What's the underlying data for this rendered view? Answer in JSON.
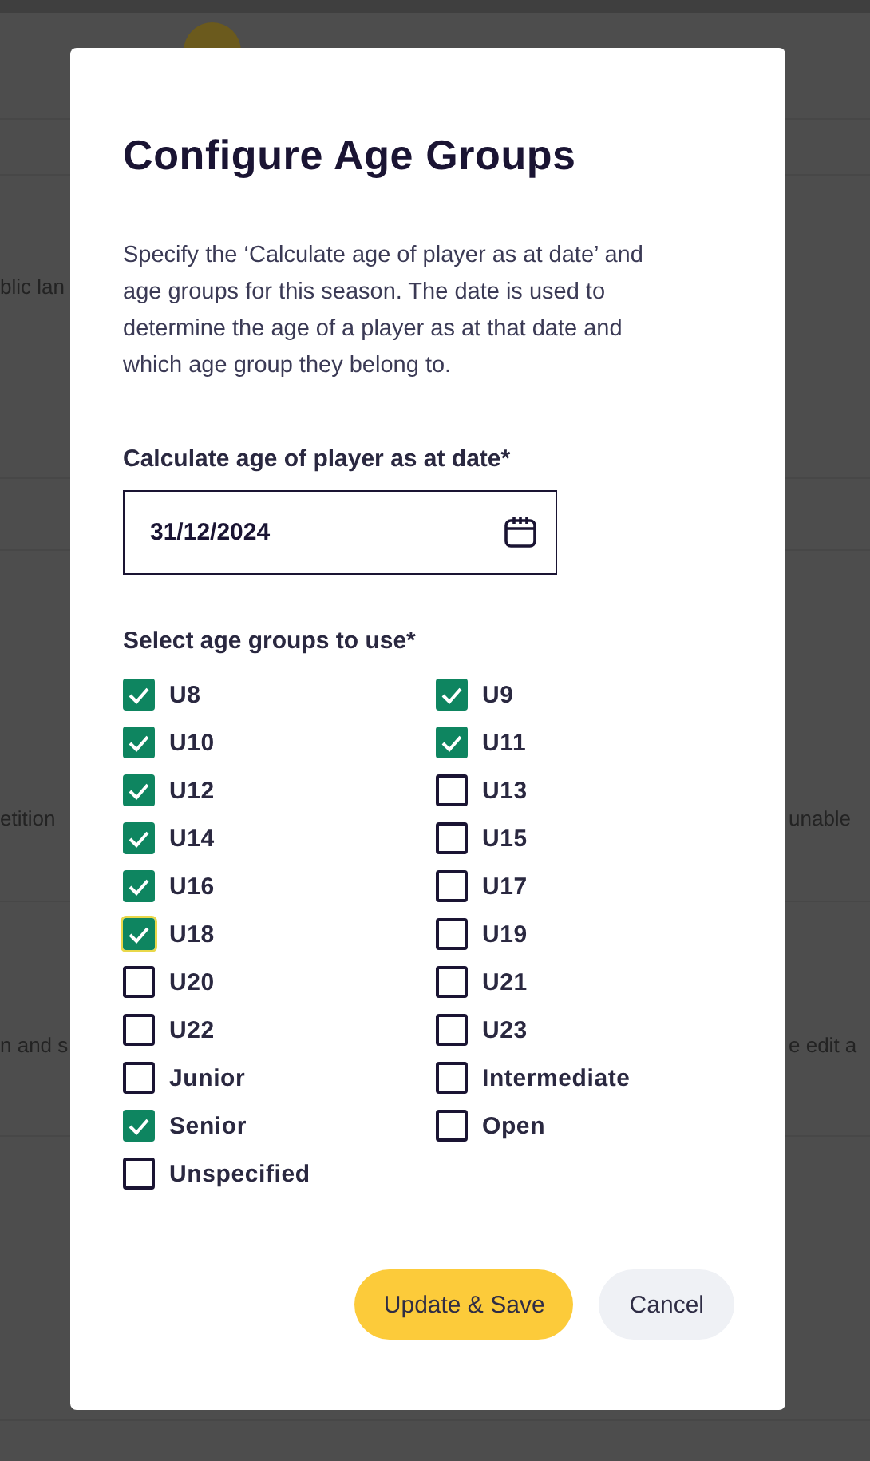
{
  "background": {
    "fragments": [
      {
        "left": "blic lan"
      },
      {
        "left": "etition",
        "right": "unable"
      },
      {
        "left": "n and s",
        "right": "e edit a"
      }
    ]
  },
  "dialog": {
    "title": "Configure Age Groups",
    "description": "Specify the ‘Calculate age of player as at date’ and age groups for this season. The date is used to determine the age of a player as at that date and which age group they belong to.",
    "date_field": {
      "label": "Calculate age of player as at date*",
      "value": "31/12/2024"
    },
    "groups_label": "Select age groups to use*",
    "age_groups": [
      {
        "label": "U8",
        "checked": true,
        "focused": false
      },
      {
        "label": "U9",
        "checked": true,
        "focused": false
      },
      {
        "label": "U10",
        "checked": true,
        "focused": false
      },
      {
        "label": "U11",
        "checked": true,
        "focused": false
      },
      {
        "label": "U12",
        "checked": true,
        "focused": false
      },
      {
        "label": "U13",
        "checked": false,
        "focused": false
      },
      {
        "label": "U14",
        "checked": true,
        "focused": false
      },
      {
        "label": "U15",
        "checked": false,
        "focused": false
      },
      {
        "label": "U16",
        "checked": true,
        "focused": false
      },
      {
        "label": "U17",
        "checked": false,
        "focused": false
      },
      {
        "label": "U18",
        "checked": true,
        "focused": true
      },
      {
        "label": "U19",
        "checked": false,
        "focused": false
      },
      {
        "label": "U20",
        "checked": false,
        "focused": false
      },
      {
        "label": "U21",
        "checked": false,
        "focused": false
      },
      {
        "label": "U22",
        "checked": false,
        "focused": false
      },
      {
        "label": "U23",
        "checked": false,
        "focused": false
      },
      {
        "label": "Junior",
        "checked": false,
        "focused": false
      },
      {
        "label": "Intermediate",
        "checked": false,
        "focused": false
      },
      {
        "label": "Senior",
        "checked": true,
        "focused": false
      },
      {
        "label": "Open",
        "checked": false,
        "focused": false
      },
      {
        "label": "Unspecified",
        "checked": false,
        "focused": false
      }
    ],
    "buttons": [
      {
        "label": "Update & Save",
        "kind": "primary"
      },
      {
        "label": "Cancel",
        "kind": "secondary"
      }
    ]
  }
}
